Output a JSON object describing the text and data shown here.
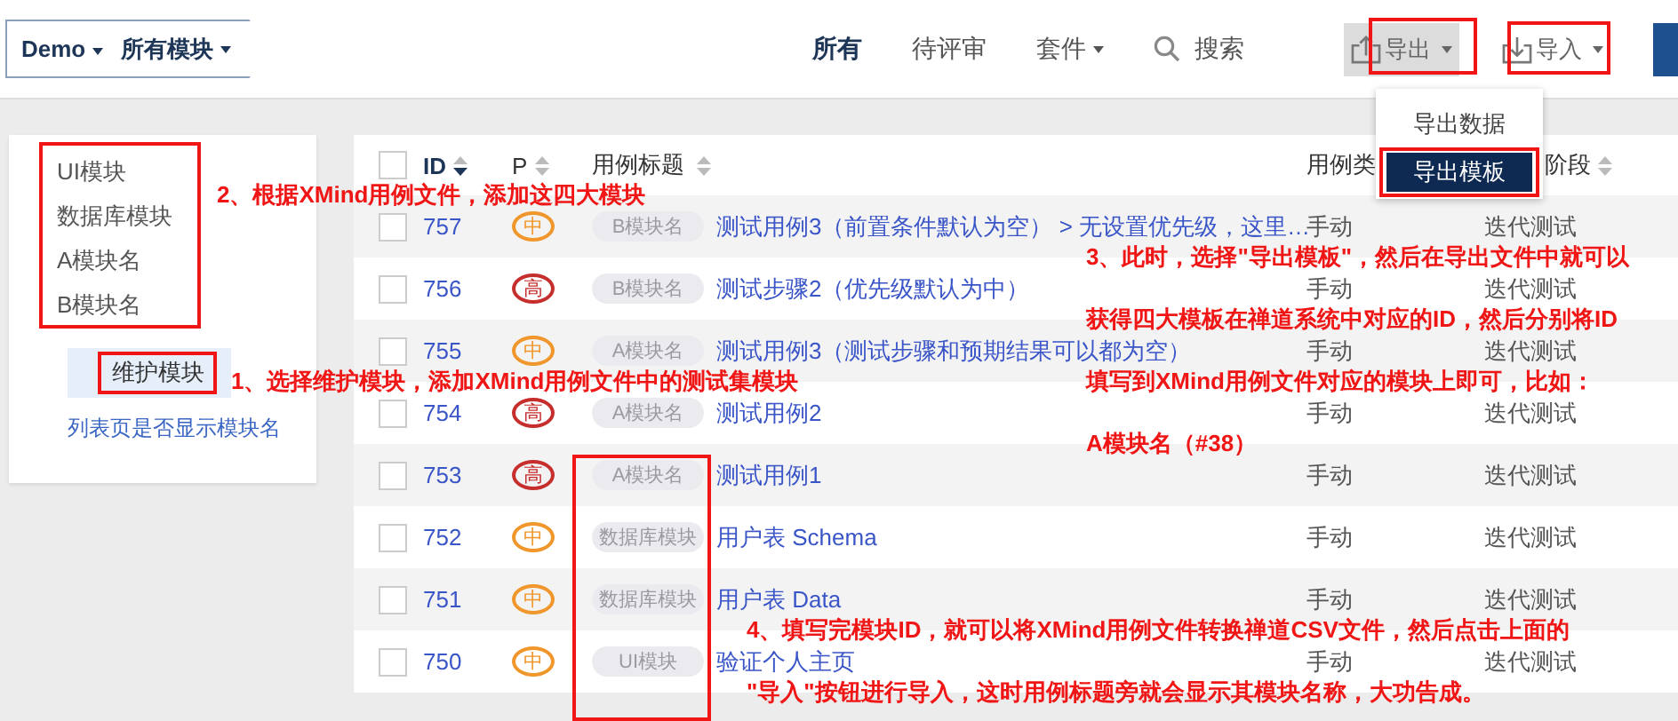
{
  "breadcrumb": {
    "project": "Demo",
    "module": "所有模块"
  },
  "nav": [
    {
      "label": "所有",
      "selected": true,
      "dropdown": false
    },
    {
      "label": "待评审",
      "selected": false,
      "dropdown": false
    },
    {
      "label": "套件",
      "selected": false,
      "dropdown": true
    }
  ],
  "search": {
    "label": "搜索"
  },
  "actions": [
    {
      "label": "导出",
      "kind": "export",
      "open": true
    },
    {
      "label": "导入",
      "kind": "import",
      "open": false
    }
  ],
  "export_menu": [
    {
      "label": "导出数据",
      "selected": false
    },
    {
      "label": "导出模板",
      "selected": true
    }
  ],
  "sidebar": {
    "modules": [
      "UI模块",
      "数据库模块",
      "A模块名",
      "B模块名"
    ],
    "maintain_button": "维护模块",
    "show_module_link": "列表页是否显示模块名"
  },
  "table": {
    "select_all": {
      "checked": false
    },
    "columns": [
      {
        "label": "ID",
        "sorted": true
      },
      {
        "label": "P",
        "sorted": false
      },
      {
        "label": "用例标题",
        "sorted": false
      },
      {
        "label": "用例类",
        "sorted": false
      },
      {
        "label": "阶段",
        "sorted": false
      }
    ],
    "rows": [
      {
        "id": "757",
        "checked": false,
        "priority": {
          "label": "中",
          "color": "#f0962a"
        },
        "module": "B模块名",
        "title": "测试用例3（前置条件默认为空） > 无设置优先级，这里…",
        "type": "手动",
        "stage": "迭代测试"
      },
      {
        "id": "756",
        "checked": false,
        "priority": {
          "label": "高",
          "color": "#c62d2d"
        },
        "module": "B模块名",
        "title": "测试步骤2（优先级默认为中）",
        "type": "手动",
        "stage": "迭代测试"
      },
      {
        "id": "755",
        "checked": false,
        "priority": {
          "label": "中",
          "color": "#f0962a"
        },
        "module": "A模块名",
        "title": "测试用例3（测试步骤和预期结果可以都为空）",
        "type": "手动",
        "stage": "迭代测试"
      },
      {
        "id": "754",
        "checked": false,
        "priority": {
          "label": "高",
          "color": "#c62d2d"
        },
        "module": "A模块名",
        "title": "测试用例2",
        "type": "手动",
        "stage": "迭代测试"
      },
      {
        "id": "753",
        "checked": false,
        "priority": {
          "label": "高",
          "color": "#c62d2d"
        },
        "module": "A模块名",
        "title": "测试用例1",
        "type": "手动",
        "stage": "迭代测试"
      },
      {
        "id": "752",
        "checked": false,
        "priority": {
          "label": "中",
          "color": "#f0962a"
        },
        "module": "数据库模块",
        "title": "用户表 Schema",
        "type": "手动",
        "stage": "迭代测试"
      },
      {
        "id": "751",
        "checked": false,
        "priority": {
          "label": "中",
          "color": "#f0962a"
        },
        "module": "数据库模块",
        "title": "用户表 Data",
        "type": "手动",
        "stage": "迭代测试"
      },
      {
        "id": "750",
        "checked": false,
        "priority": {
          "label": "中",
          "color": "#f0962a"
        },
        "module": "UI模块",
        "title": "验证个人主页",
        "type": "手动",
        "stage": "迭代测试"
      }
    ]
  },
  "annotations": [
    {
      "lines": [
        "2、根据XMind用例文件，添加这四大模块"
      ]
    },
    {
      "lines": [
        "3、此时，选择\"导出模板\"，然后在导出文件中就可以",
        "获得四大模板在禅道系统中对应的ID，然后分别将ID",
        "填写到XMind用例文件对应的模块上即可，比如：",
        "A模块名（#38）"
      ]
    },
    {
      "lines": [
        "1、选择维护模块，添加XMind用例文件中的测试集模块"
      ]
    },
    {
      "lines": [
        "4、填写完模块ID，就可以将XMind用例文件转换禅道CSV文件，然后点击上面的",
        "\"导入\"按钮进行导入，这时用例标题旁就会显示其模块名称，大功告成。"
      ]
    }
  ]
}
